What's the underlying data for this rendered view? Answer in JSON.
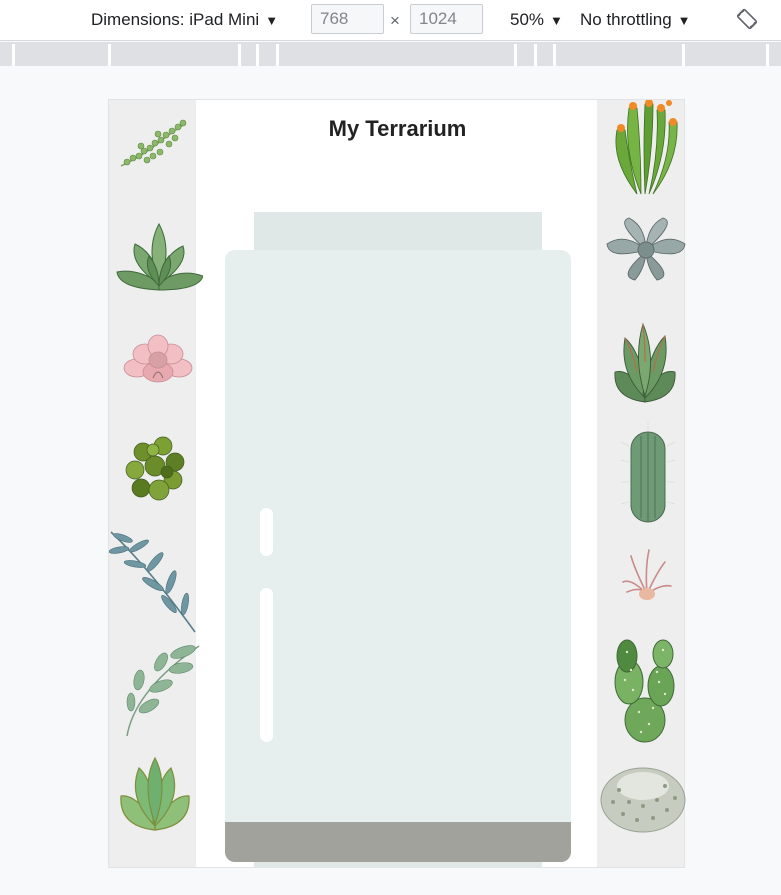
{
  "devtools": {
    "dimensions_label": "Dimensions: iPad Mini",
    "width_value": "768",
    "height_value": "1024",
    "times_symbol": "×",
    "zoom_label": "50%",
    "throttling_label": "No throttling",
    "caret": "▼"
  },
  "page": {
    "title": "My Terrarium"
  },
  "plants": {
    "left": [
      "string-of-pearls",
      "green-rosette-succulent",
      "pink-echeveria",
      "green-clover-plant",
      "blue-eucalyptus-sprig",
      "green-leaf-sprig",
      "jade-echeveria"
    ],
    "right": [
      "orange-tipped-cactus",
      "grey-rosette-succulent",
      "aloe-succulent",
      "columnar-cactus",
      "air-plant",
      "prickly-pear-cactus",
      "fuzzy-ball-cactus"
    ]
  },
  "colors": {
    "sidebar": "#eeeeee",
    "jar": "#e7eeee",
    "jar_lid": "#dfe8e7",
    "soil": "#a2a29c",
    "background": "#f8f9fa"
  }
}
